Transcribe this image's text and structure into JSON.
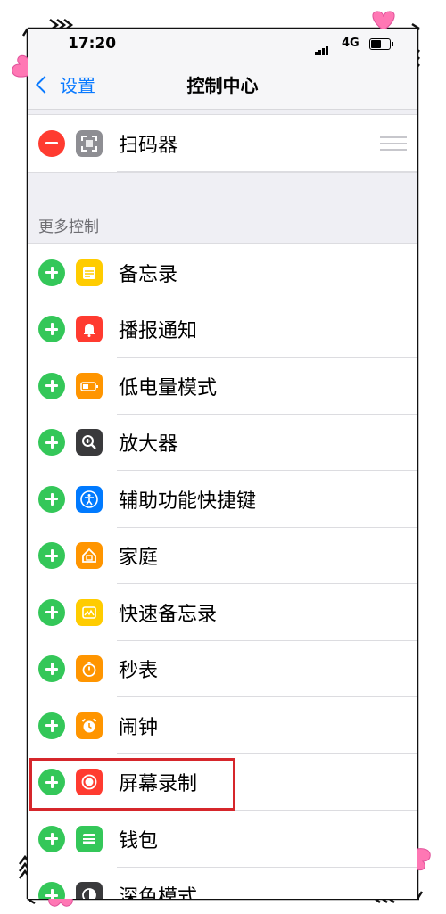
{
  "status_bar": {
    "time": "17:20",
    "network": "4G"
  },
  "nav": {
    "back_label": "设置",
    "title": "控制中心"
  },
  "included_controls": [
    {
      "label": "扫码器",
      "icon": "qr-scanner-icon",
      "color": "#8e8e93",
      "action": "remove"
    }
  ],
  "more_controls": {
    "header": "更多控制",
    "items": [
      {
        "label": "备忘录",
        "icon": "notes-icon",
        "color": "#ffcc00"
      },
      {
        "label": "播报通知",
        "icon": "announce-notifications-icon",
        "color": "#ff3b30"
      },
      {
        "label": "低电量模式",
        "icon": "low-power-battery-icon",
        "color": "#ff9500"
      },
      {
        "label": "放大器",
        "icon": "magnifier-icon",
        "color": "#3a3a3c"
      },
      {
        "label": "辅助功能快捷键",
        "icon": "accessibility-icon",
        "color": "#007aff"
      },
      {
        "label": "家庭",
        "icon": "home-icon",
        "color": "#ff9500"
      },
      {
        "label": "快速备忘录",
        "icon": "quick-note-icon",
        "color": "#ffcc00"
      },
      {
        "label": "秒表",
        "icon": "stopwatch-icon",
        "color": "#ff9500"
      },
      {
        "label": "闹钟",
        "icon": "alarm-clock-icon",
        "color": "#ff9500"
      },
      {
        "label": "屏幕录制",
        "icon": "screen-recording-icon",
        "color": "#ff3b30",
        "highlighted": true
      },
      {
        "label": "钱包",
        "icon": "wallet-icon",
        "color": "#34c759"
      },
      {
        "label": "深色模式",
        "icon": "dark-mode-icon",
        "color": "#3a3a3c"
      }
    ]
  },
  "colors": {
    "add": "#34c759",
    "remove": "#ff3b30",
    "link": "#0a7aff",
    "highlight_border": "#d6262b"
  }
}
